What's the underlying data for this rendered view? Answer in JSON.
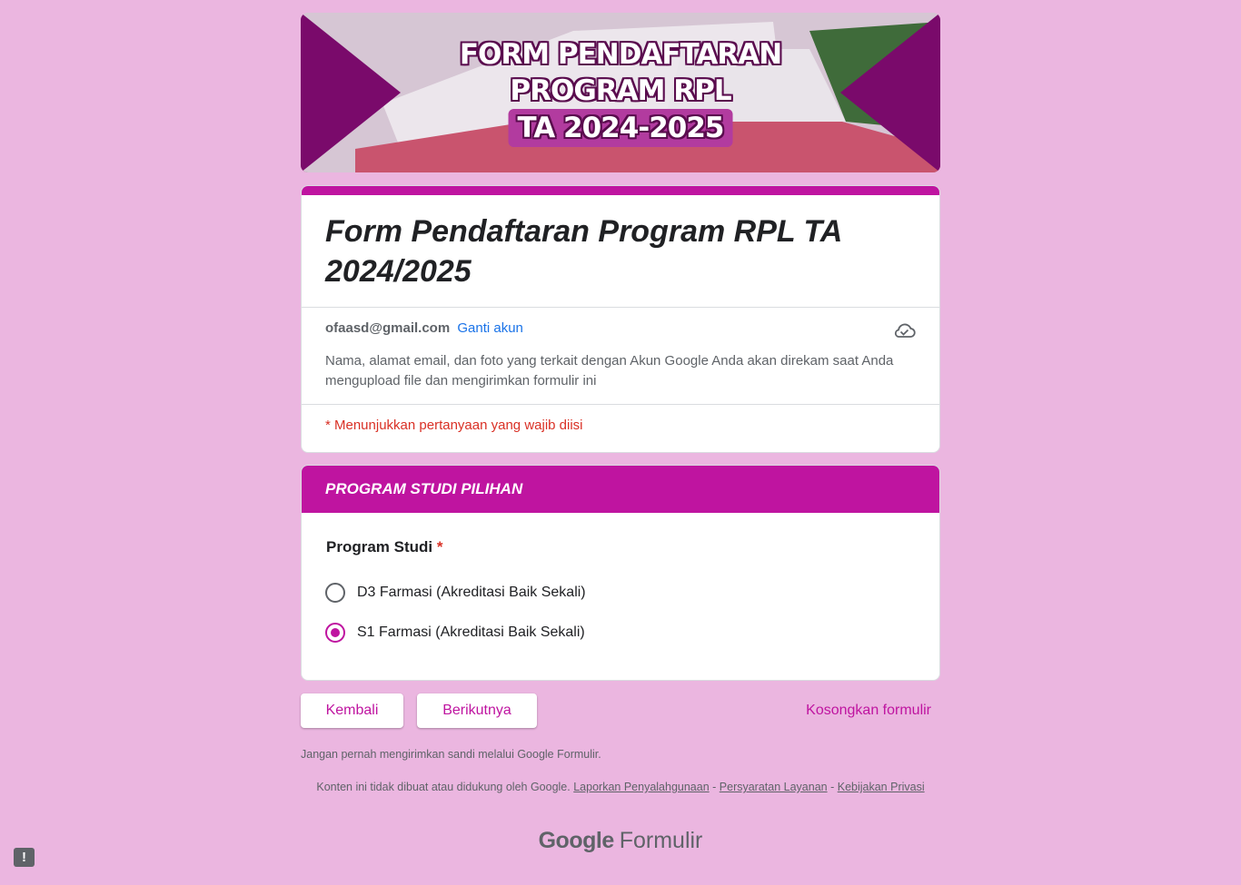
{
  "banner": {
    "line1": "FORM PENDAFTARAN",
    "line2": "PROGRAM RPL",
    "line3": "TA 2024-2025"
  },
  "form": {
    "title": "Form Pendaftaran Program RPL TA 2024/2025",
    "account_email": "ofaasd@gmail.com",
    "switch_account": "Ganti akun",
    "privacy_notice": "Nama, alamat email, dan foto yang terkait dengan Akun Google Anda akan direkam saat Anda mengupload file dan mengirimkan formulir ini",
    "required_note": "* Menunjukkan pertanyaan yang wajib diisi"
  },
  "section": {
    "title": "PROGRAM STUDI PILIHAN",
    "question": {
      "label": "Program Studi",
      "required_mark": "*",
      "options": [
        {
          "label": "D3 Farmasi (Akreditasi Baik Sekali)",
          "selected": false
        },
        {
          "label": "S1 Farmasi (Akreditasi Baik Sekali)",
          "selected": true
        }
      ]
    }
  },
  "actions": {
    "back": "Kembali",
    "next": "Berikutnya",
    "clear": "Kosongkan formulir"
  },
  "footer": {
    "warning": "Jangan pernah mengirimkan sandi melalui Google Formulir.",
    "disclaimer": "Konten ini tidak dibuat atau didukung oleh Google.",
    "report_abuse": "Laporkan Penyalahgunaan",
    "terms": "Persyaratan Layanan",
    "privacy": "Kebijakan Privasi",
    "separator": " - ",
    "brand_google": "Google",
    "brand_product": "Formulir"
  },
  "icons": {
    "cloud": "cloud-check-icon",
    "feedback": "feedback-icon"
  },
  "colors": {
    "page_background": "#ebb6e0",
    "accent": "#bf14a0",
    "required": "#d93025",
    "link": "#1a73e8"
  }
}
